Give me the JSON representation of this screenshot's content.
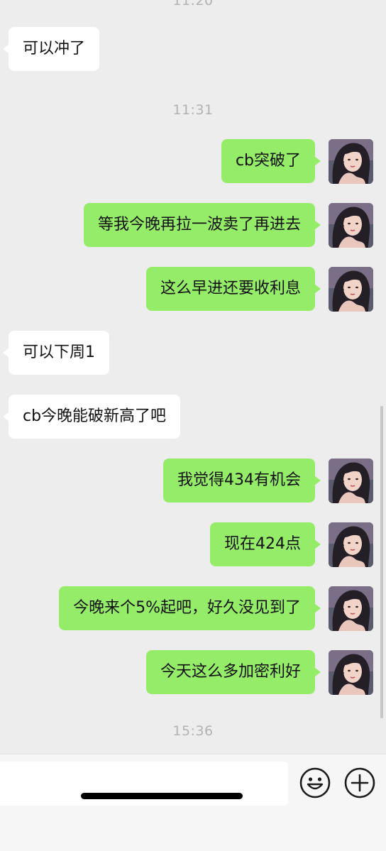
{
  "timestamps": {
    "top_partial": "11:20",
    "t1131": "11:31",
    "t1536": "15:36"
  },
  "messages": [
    {
      "side": "in",
      "text": "可以冲了"
    },
    {
      "side": "out",
      "text": "cb突破了"
    },
    {
      "side": "out",
      "text": "等我今晚再拉一波卖了再进去"
    },
    {
      "side": "out",
      "text": "这么早进还要收利息"
    },
    {
      "side": "in",
      "text": "可以下周1"
    },
    {
      "side": "in",
      "text": "cb今晚能破新高了吧"
    },
    {
      "side": "out",
      "text": "我觉得434有机会"
    },
    {
      "side": "out",
      "text": "现在424点"
    },
    {
      "side": "out",
      "text": "今晚来个5%起吧，好久没见到了"
    },
    {
      "side": "out",
      "text": "今天这么多加密利好"
    }
  ],
  "input_bar": {
    "emoji_icon": "smiley-face-icon",
    "plus_icon": "plus-circle-icon"
  },
  "colors": {
    "background": "#ededed",
    "outgoing_bubble": "#95ec69",
    "incoming_bubble": "#ffffff",
    "timestamp": "#b2b2b2"
  }
}
